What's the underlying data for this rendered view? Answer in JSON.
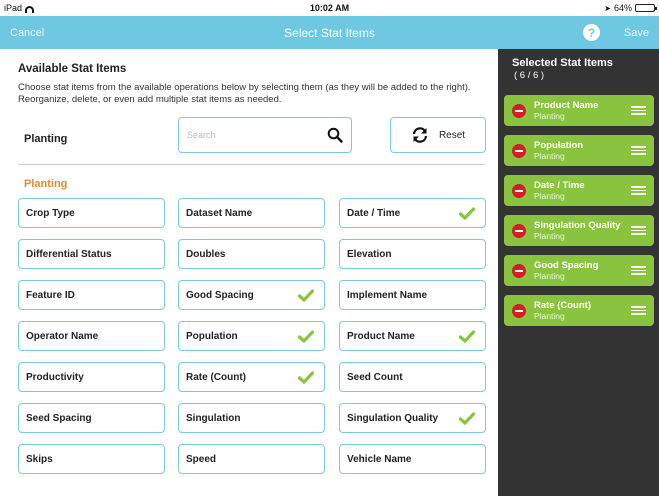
{
  "status_bar": {
    "device": "iPad",
    "time": "10:02 AM",
    "battery": "64%",
    "battery_level": 0.64
  },
  "nav": {
    "cancel": "Cancel",
    "title": "Select Stat Items",
    "help": "?",
    "save": "Save"
  },
  "main": {
    "heading": "Available Stat Items",
    "description": "Choose stat items from the available operations below by selecting them (as they will be added to the right). Reorganize, delete, or even add multiple stat items as needed.",
    "operation_label": "Planting",
    "search_placeholder": "Search",
    "reset_label": "Reset",
    "group_label": "Planting",
    "tiles": [
      {
        "label": "Crop Type",
        "checked": false
      },
      {
        "label": "Dataset Name",
        "checked": false
      },
      {
        "label": "Date / Time",
        "checked": true
      },
      {
        "label": "Differential Status",
        "checked": false
      },
      {
        "label": "Doubles",
        "checked": false
      },
      {
        "label": "Elevation",
        "checked": false
      },
      {
        "label": "Feature ID",
        "checked": false
      },
      {
        "label": "Good Spacing",
        "checked": true
      },
      {
        "label": "Implement Name",
        "checked": false
      },
      {
        "label": "Operator Name",
        "checked": false
      },
      {
        "label": "Population",
        "checked": true
      },
      {
        "label": "Product Name",
        "checked": true
      },
      {
        "label": "Productivity",
        "checked": false
      },
      {
        "label": "Rate (Count)",
        "checked": true
      },
      {
        "label": "Seed Count",
        "checked": false
      },
      {
        "label": "Seed Spacing",
        "checked": false
      },
      {
        "label": "Singulation",
        "checked": false
      },
      {
        "label": "Singulation Quality",
        "checked": true
      },
      {
        "label": "Skips",
        "checked": false
      },
      {
        "label": "Speed",
        "checked": false
      },
      {
        "label": "Vehicle Name",
        "checked": false
      }
    ]
  },
  "panel": {
    "title": "Selected Stat Items",
    "count": "( 6 / 6 )",
    "items": [
      {
        "name": "Product Name",
        "sub": "Planting"
      },
      {
        "name": "Population",
        "sub": "Planting"
      },
      {
        "name": "Date / Time",
        "sub": "Planting"
      },
      {
        "name": "Singulation Quality",
        "sub": "Planting"
      },
      {
        "name": "Good Spacing",
        "sub": "Planting"
      },
      {
        "name": "Rate (Count)",
        "sub": "Planting"
      }
    ]
  },
  "colors": {
    "nav": "#6ec8e2",
    "check": "#8ac43f",
    "group": "#e08a2e",
    "panel": "#333333",
    "remove": "#d41f29"
  }
}
